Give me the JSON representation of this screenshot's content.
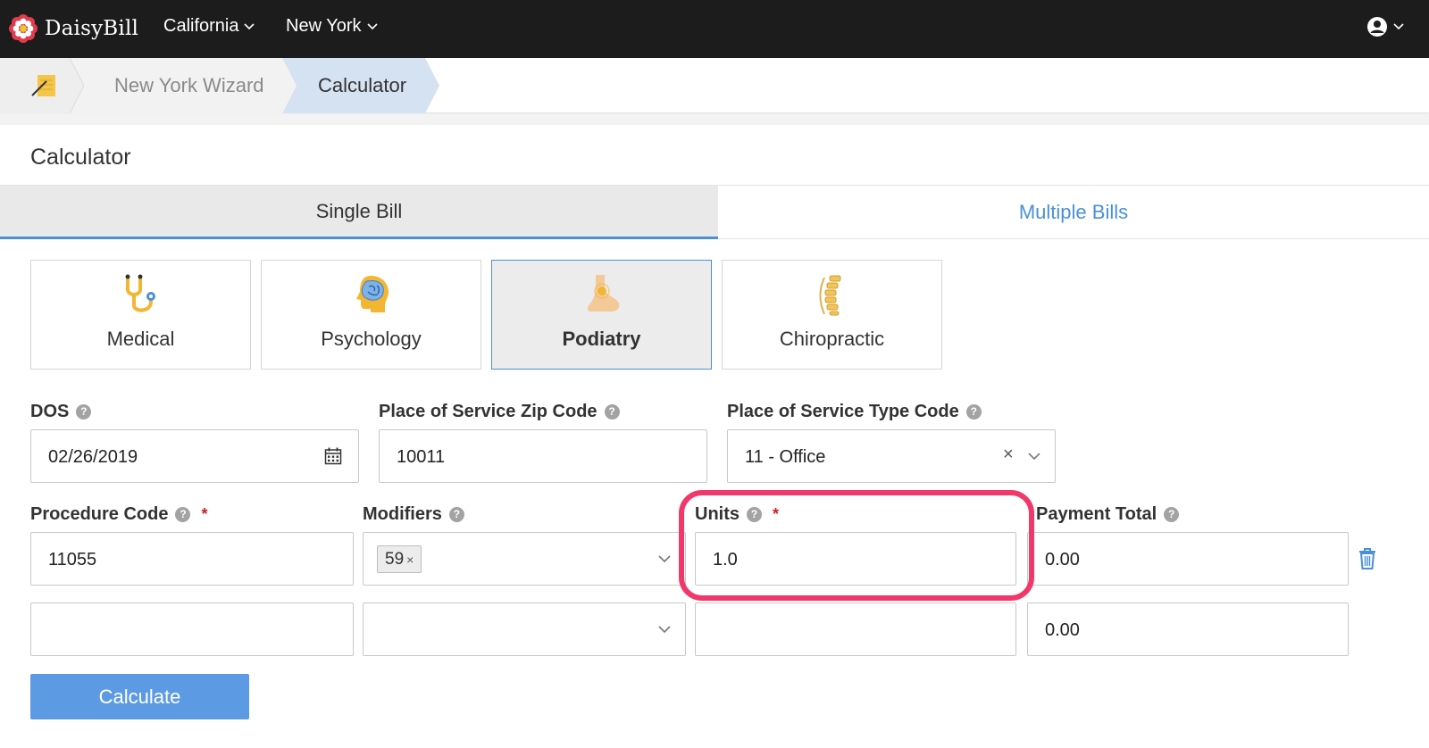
{
  "app": {
    "name": "DaisyBill"
  },
  "topnav": {
    "items": [
      {
        "label": "California"
      },
      {
        "label": "New York"
      }
    ]
  },
  "breadcrumb": {
    "items": [
      "New York Wizard",
      "Calculator"
    ]
  },
  "page": {
    "title": "Calculator"
  },
  "tabs": [
    {
      "label": "Single Bill",
      "active": true
    },
    {
      "label": "Multiple Bills",
      "active": false
    }
  ],
  "specialties": [
    {
      "label": "Medical",
      "icon": "stethoscope-icon"
    },
    {
      "label": "Psychology",
      "icon": "brain-icon"
    },
    {
      "label": "Podiatry",
      "icon": "foot-icon",
      "active": true
    },
    {
      "label": "Chiropractic",
      "icon": "spine-icon"
    }
  ],
  "form": {
    "dos": {
      "label": "DOS",
      "value": "02/26/2019"
    },
    "zip": {
      "label": "Place of Service Zip Code",
      "value": "10011"
    },
    "pos_type": {
      "label": "Place of Service Type Code",
      "value": "11 - Office"
    },
    "procedure": {
      "label": "Procedure Code",
      "required_mark": "*"
    },
    "modifiers": {
      "label": "Modifiers"
    },
    "units": {
      "label": "Units",
      "required_mark": "*"
    },
    "payment": {
      "label": "Payment Total"
    },
    "help_glyph": "?",
    "rows": [
      {
        "procedure": "11055",
        "modifier_chip": "59",
        "units": "1.0",
        "payment": "0.00"
      },
      {
        "procedure": "",
        "modifier_chip": "",
        "units": "",
        "payment": "0.00"
      }
    ],
    "chip_remove": "×",
    "clear_glyph": "×"
  },
  "actions": {
    "calculate_label": "Calculate"
  },
  "colors": {
    "accent": "#4a90d9",
    "button": "#5c9ae3",
    "highlight": "#f0386b",
    "nav": "#1c1c1c"
  }
}
